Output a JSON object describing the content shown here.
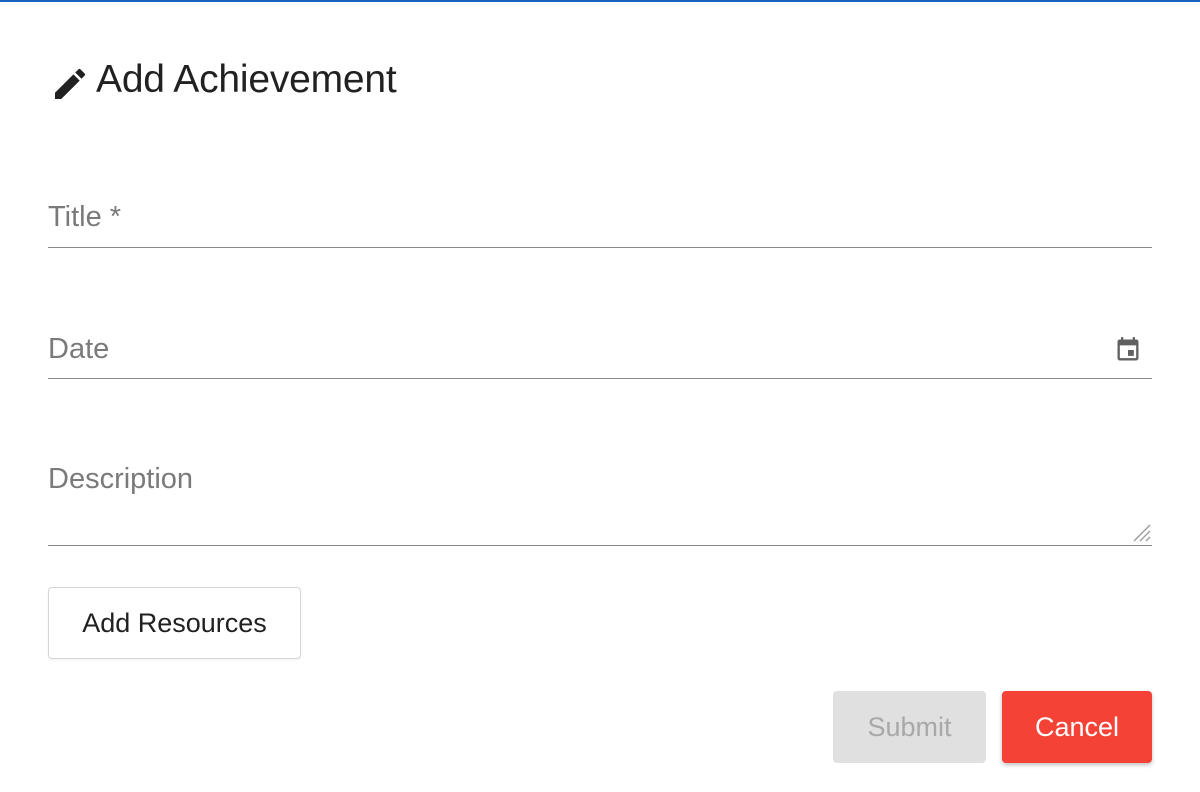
{
  "dialog": {
    "title": "Add Achievement",
    "title_icon": "pencil-icon",
    "accent_color": "#1565c0"
  },
  "form": {
    "title_field": {
      "label": "Title *",
      "value": ""
    },
    "date_field": {
      "label": "Date",
      "value": "",
      "icon": "calendar-icon"
    },
    "description_field": {
      "label": "Description",
      "value": ""
    }
  },
  "buttons": {
    "add_resources": "Add Resources",
    "submit": "Submit",
    "cancel": "Cancel",
    "submit_disabled": true,
    "cancel_color": "#f44336"
  }
}
